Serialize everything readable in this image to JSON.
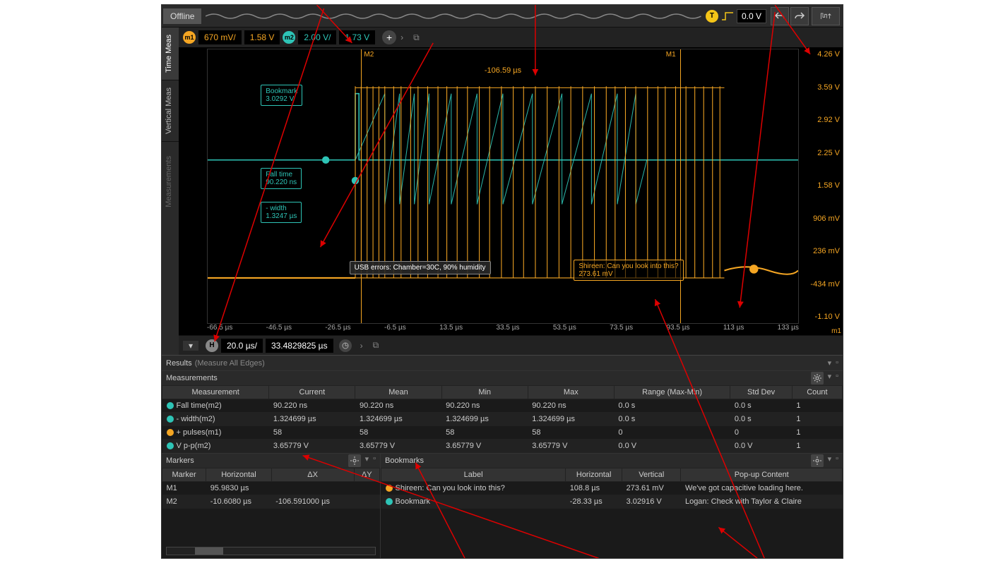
{
  "status": "Offline",
  "trigger": {
    "label": "T",
    "value": "0.0 V"
  },
  "channels": {
    "m1": {
      "badge": "m1",
      "scale": "670 mV/",
      "offset": "1.58 V"
    },
    "m2": {
      "badge": "m2",
      "scale": "2.00 V/",
      "offset": "1.73 V"
    }
  },
  "timebase": {
    "badge": "H",
    "scale": "20.0 µs/",
    "position": "33.4829825 µs"
  },
  "markers_delta": "-106.59 µs",
  "marker_labels": {
    "m1": "M1",
    "m2": "M2"
  },
  "y_ticks": [
    "4.26 V",
    "3.59 V",
    "2.92 V",
    "2.25 V",
    "1.58 V",
    "906 mV",
    "236 mV",
    "-434 mV",
    "-1.10 V"
  ],
  "x_ticks": [
    "-66.5 µs",
    "-46.5 µs",
    "-26.5 µs",
    "-6.5 µs",
    "13.5 µs",
    "33.5 µs",
    "53.5 µs",
    "73.5 µs",
    "93.5 µs",
    "113 µs",
    "133 µs"
  ],
  "x_axis_unit": "m1",
  "annotations": {
    "bookmark_teal": "Bookmark\n3.0292 V",
    "falltime": "Fall time\n90.220 ns",
    "negwidth": "- width\n1.3247 µs",
    "usb_note": "USB errors: Chamber=30C, 90% humidity",
    "shireen_note": "Shireen: Can you look into this?\n273.61 mV"
  },
  "side_tabs": {
    "time": "Time Meas",
    "vertical": "Vertical Meas",
    "measurements": "Measurements"
  },
  "results": {
    "title": "Results",
    "sub": "(Measure All Edges)"
  },
  "measurements": {
    "title": "Measurements",
    "columns": [
      "Measurement",
      "Current",
      "Mean",
      "Min",
      "Max",
      "Range (Max-Min)",
      "Std Dev",
      "Count"
    ],
    "rows": [
      {
        "color": "teal",
        "name": "Fall time(m2)",
        "current": "90.220 ns",
        "mean": "90.220 ns",
        "min": "90.220 ns",
        "max": "90.220 ns",
        "range": "0.0 s",
        "std": "0.0 s",
        "count": "1"
      },
      {
        "color": "teal",
        "name": "- width(m2)",
        "current": "1.324699 µs",
        "mean": "1.324699 µs",
        "min": "1.324699 µs",
        "max": "1.324699 µs",
        "range": "0.0 s",
        "std": "0.0 s",
        "count": "1"
      },
      {
        "color": "orange",
        "name": "+ pulses(m1)",
        "current": "58",
        "mean": "58",
        "min": "58",
        "max": "58",
        "range": "0",
        "std": "0",
        "count": "1"
      },
      {
        "color": "teal",
        "name": "V p-p(m2)",
        "current": "3.65779 V",
        "mean": "3.65779 V",
        "min": "3.65779 V",
        "max": "3.65779 V",
        "range": "0.0 V",
        "std": "0.0 V",
        "count": "1"
      }
    ]
  },
  "markers_panel": {
    "title": "Markers",
    "columns": [
      "Marker",
      "Horizontal",
      "ΔX",
      "ΔY"
    ],
    "rows": [
      {
        "name": "M1",
        "horizontal": "95.9830 µs",
        "dx": "",
        "dy": ""
      },
      {
        "name": "M2",
        "horizontal": "-10.6080 µs",
        "dx": "-106.591000 µs",
        "dy": ""
      }
    ]
  },
  "bookmarks_panel": {
    "title": "Bookmarks",
    "columns": [
      "Label",
      "Horizontal",
      "Vertical",
      "Pop-up Content"
    ],
    "rows": [
      {
        "color": "orange",
        "label": "Shireen: Can you look into this?",
        "horizontal": "108.8 µs",
        "vertical": "273.61 mV",
        "popup": "We've got capacitive loading here."
      },
      {
        "color": "teal",
        "label": "Bookmark",
        "horizontal": "-28.33 µs",
        "vertical": "3.02916 V",
        "popup": "Logan: Check with Taylor & Claire"
      }
    ]
  }
}
